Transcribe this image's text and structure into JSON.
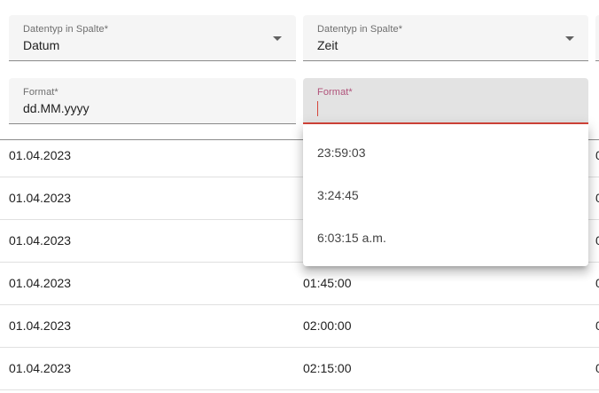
{
  "columns": [
    {
      "type_field": {
        "label": "Datentyp in Spalte*",
        "value": "Datum"
      },
      "format_field": {
        "label": "Format*",
        "value": "dd.MM.yyyy"
      }
    },
    {
      "type_field": {
        "label": "Datentyp in Spalte*",
        "value": "Zeit"
      },
      "format_field": {
        "label": "Format*",
        "value": ""
      }
    }
  ],
  "format_options": [
    "23:59:03",
    "3:24:45",
    "6:03:15 a.m."
  ],
  "rows": [
    {
      "col1": "01.04.2023",
      "col2": "",
      "col3": "0"
    },
    {
      "col1": "01.04.2023",
      "col2": "",
      "col3": "0"
    },
    {
      "col1": "01.04.2023",
      "col2": "",
      "col3": "0"
    },
    {
      "col1": "01.04.2023",
      "col2": "01:45:00",
      "col3": "0"
    },
    {
      "col1": "01.04.2023",
      "col2": "02:00:00",
      "col3": "0"
    },
    {
      "col1": "01.04.2023",
      "col2": "02:15:00",
      "col3": "0"
    }
  ],
  "colors": {
    "accent": "#d6453a",
    "focused_label": "#b0527a"
  }
}
